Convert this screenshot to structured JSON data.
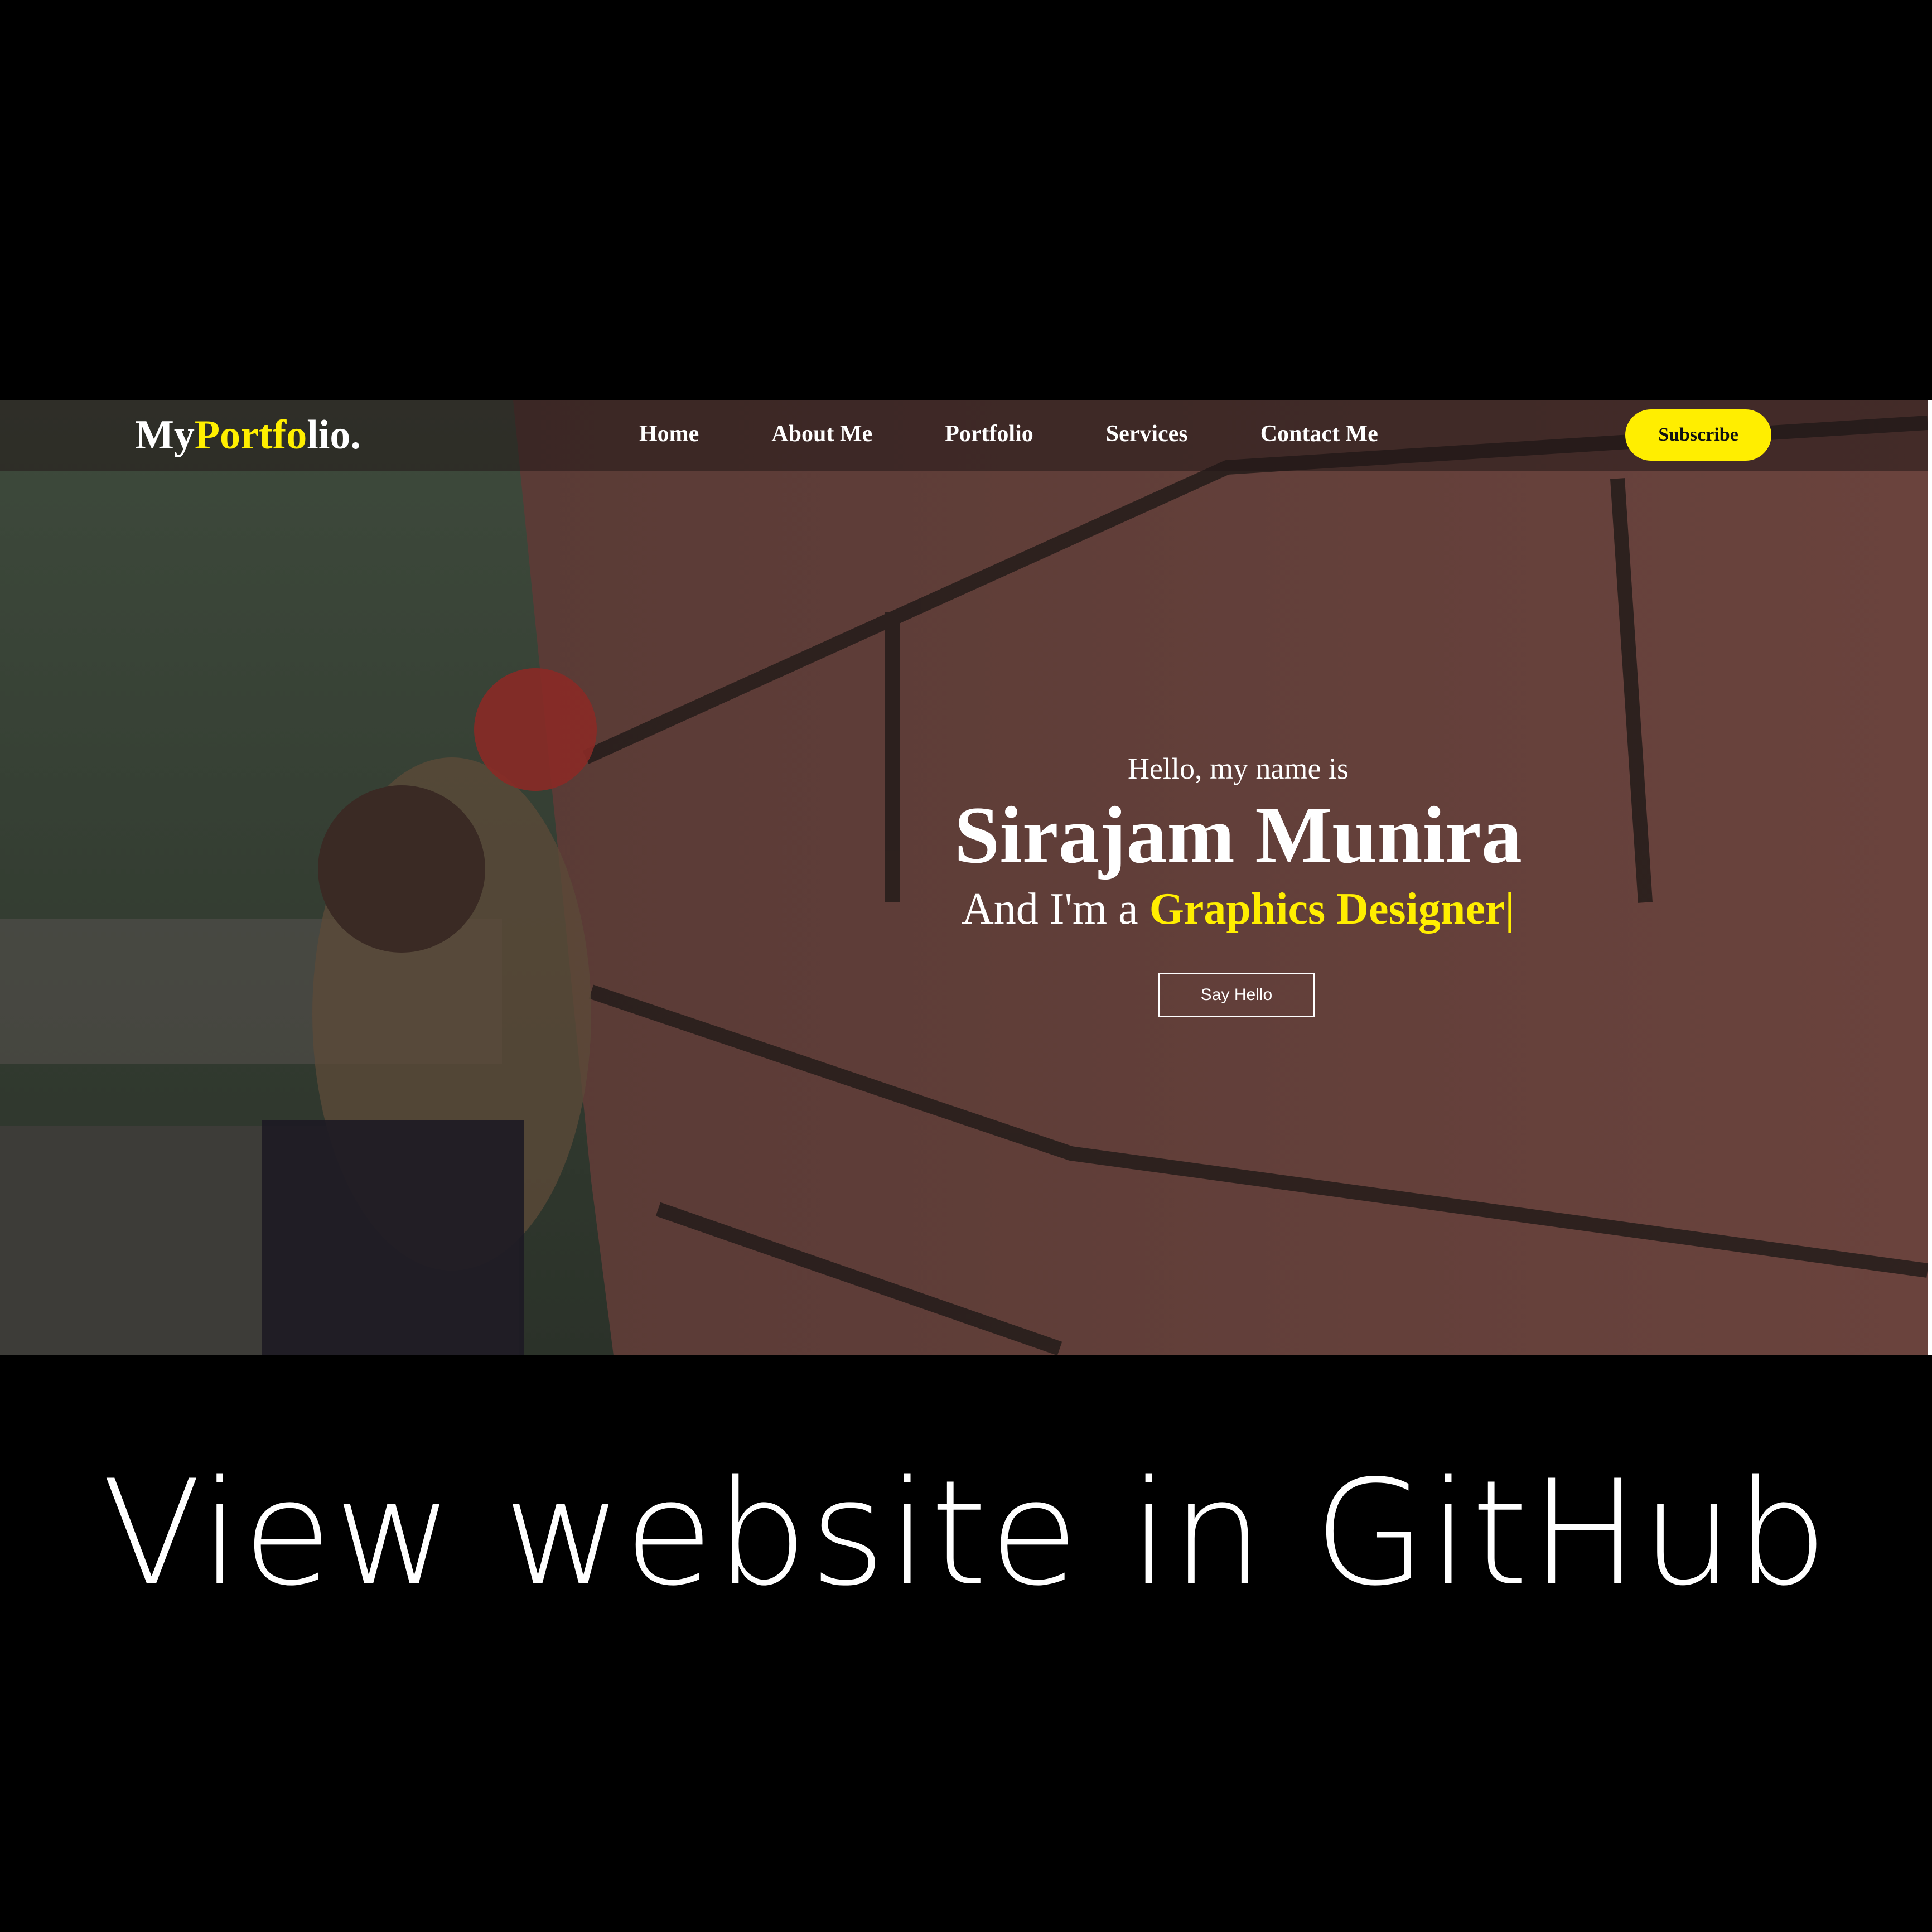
{
  "header": {
    "brand_prefix": "My",
    "brand_accent": "Portfo",
    "brand_suffix": "lio."
  },
  "nav": {
    "items": [
      {
        "label": "Home"
      },
      {
        "label": "About Me"
      },
      {
        "label": "Portfolio"
      },
      {
        "label": "Services"
      },
      {
        "label": "Contact Me"
      }
    ],
    "subscribe_label": "Subscribe"
  },
  "hero": {
    "greeting": "Hello, my name is",
    "name": "Sirajam Munira",
    "role_prefix": "And I'm a ",
    "role_title": "Graphics Designer",
    "cursor": "|",
    "button_label": "Say Hello"
  },
  "caption": "View website in GitHub",
  "colors": {
    "accent": "#ffee00",
    "page_background": "#000000"
  }
}
